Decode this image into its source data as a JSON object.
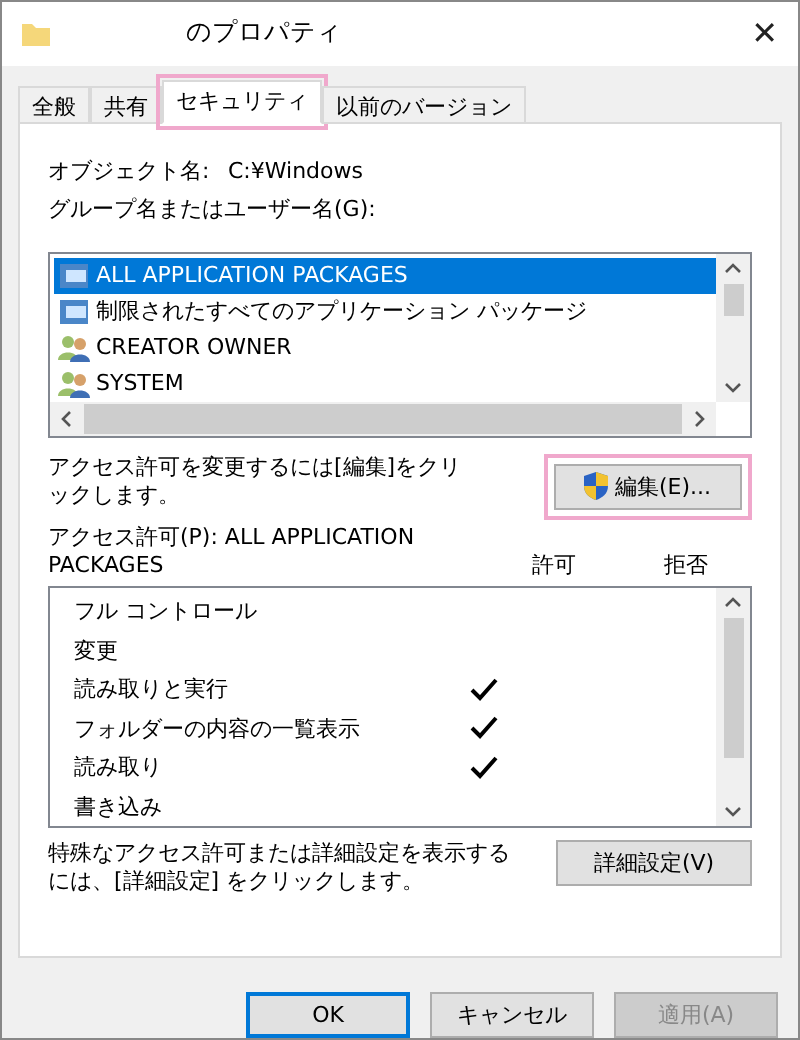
{
  "window": {
    "title": "のプロパティ",
    "close": "✕"
  },
  "tabs": [
    {
      "label": "全般",
      "selected": false,
      "highlighted": false
    },
    {
      "label": "共有",
      "selected": false,
      "highlighted": false
    },
    {
      "label": "セキュリティ",
      "selected": true,
      "highlighted": true
    },
    {
      "label": "以前のバージョン",
      "selected": false,
      "highlighted": false
    }
  ],
  "object_name": {
    "label": "オブジェクト名:",
    "value": "C:¥Windows"
  },
  "principals": {
    "label": "グループ名またはユーザー名(G):",
    "items": [
      {
        "name": "ALL APPLICATION PACKAGES",
        "kind": "package",
        "selected": true
      },
      {
        "name": "制限されたすべてのアプリケーション パッケージ",
        "kind": "package",
        "selected": false
      },
      {
        "name": "CREATOR OWNER",
        "kind": "users",
        "selected": false
      },
      {
        "name": "SYSTEM",
        "kind": "users",
        "selected": false
      }
    ]
  },
  "edit_note": "アクセス許可を変更するには[編集]をクリックします。",
  "edit_button": {
    "label": "編集(E)...",
    "highlighted": true
  },
  "permissions": {
    "label": "アクセス許可(P): ALL APPLICATION PACKAGES",
    "columns": [
      "許可",
      "拒否"
    ],
    "rows": [
      {
        "name": "フル コントロール",
        "allow": false,
        "deny": false
      },
      {
        "name": "変更",
        "allow": false,
        "deny": false
      },
      {
        "name": "読み取りと実行",
        "allow": true,
        "deny": false
      },
      {
        "name": "フォルダーの内容の一覧表示",
        "allow": true,
        "deny": false
      },
      {
        "name": "読み取り",
        "allow": true,
        "deny": false
      },
      {
        "name": "書き込み",
        "allow": false,
        "deny": false
      }
    ]
  },
  "advanced_note": "特殊なアクセス許可または詳細設定を表示するには、[詳細設定] をクリックします。",
  "advanced_button": "詳細設定(V)",
  "buttons": [
    {
      "label": "OK",
      "default": true,
      "disabled": false
    },
    {
      "label": "キャンセル",
      "default": false,
      "disabled": false
    },
    {
      "label": "適用(A)",
      "default": false,
      "disabled": true
    }
  ]
}
